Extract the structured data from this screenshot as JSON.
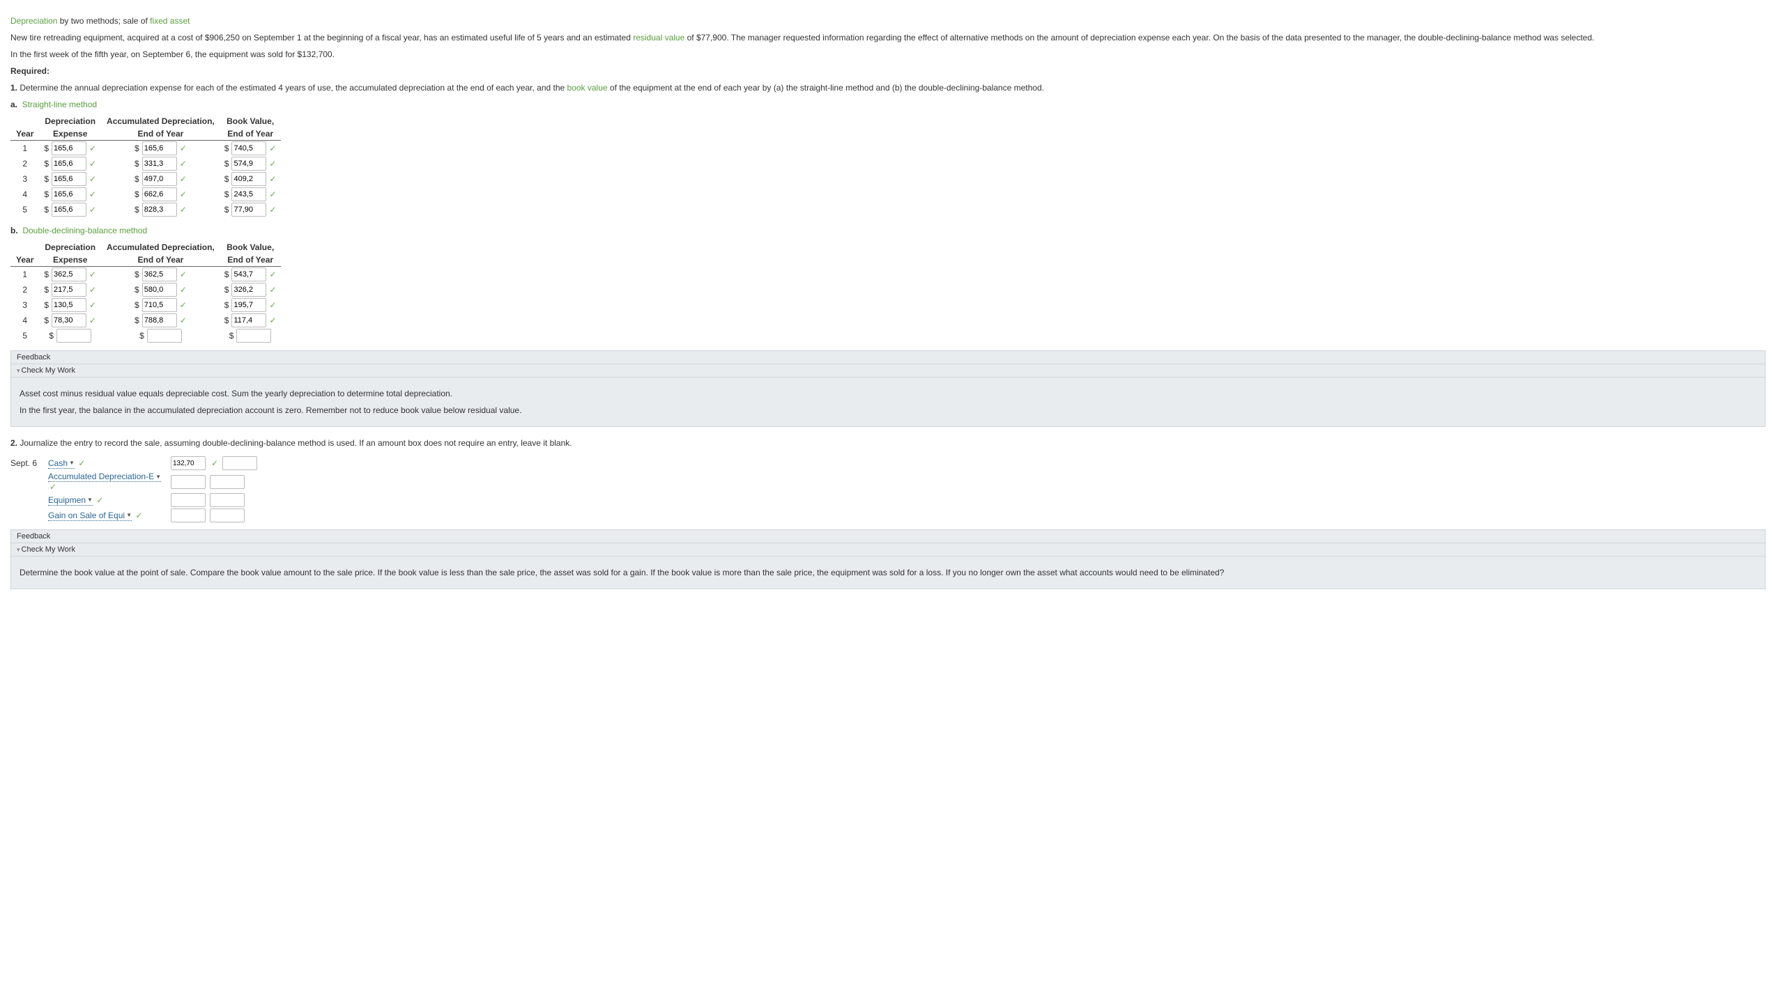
{
  "title": {
    "pre": "Depreciation",
    "mid": " by two methods; sale of ",
    "post": "fixed asset"
  },
  "para1": {
    "a": "New tire retreading equipment, acquired at a cost of $906,250 on September 1 at the beginning of a fiscal year, has an estimated useful life of 5 years and an estimated ",
    "b": "residual value",
    "c": " of $77,900. The manager requested information regarding the effect of alternative methods on the amount of depreciation expense each year. On the basis of the data presented to the manager, the double-declining-balance method was selected."
  },
  "para2": "In the first week of the fifth year, on September 6, the equipment was sold for $132,700.",
  "required": "Required:",
  "q1": {
    "num": "1.",
    "a": " Determine the annual depreciation expense for each of the estimated 4 years of use, the accumulated depreciation at the end of each year, and the ",
    "b": "book value",
    "c": " of the equipment at the end of each year by (a) the straight-line method and (b) the double-declining-balance method."
  },
  "partA": {
    "label": "a.",
    "link": "Straight-line method"
  },
  "partB": {
    "label": "b.",
    "link": "Double-declining-balance method"
  },
  "headers": {
    "year": "Year",
    "dep1": "Depreciation",
    "dep2": "Expense",
    "acc1": "Accumulated Depreciation,",
    "acc2": "End of Year",
    "bv1": "Book Value,",
    "bv2": "End of Year"
  },
  "tableA": [
    {
      "y": "1",
      "d": "165,6",
      "a": "165,6",
      "b": "740,5"
    },
    {
      "y": "2",
      "d": "165,6",
      "a": "331,3",
      "b": "574,9"
    },
    {
      "y": "3",
      "d": "165,6",
      "a": "497,0",
      "b": "409,2"
    },
    {
      "y": "4",
      "d": "165,6",
      "a": "662,6",
      "b": "243,5"
    },
    {
      "y": "5",
      "d": "165,6",
      "a": "828,3",
      "b": "77,90"
    }
  ],
  "tableB": [
    {
      "y": "1",
      "d": "362,5",
      "a": "362,5",
      "b": "543,7"
    },
    {
      "y": "2",
      "d": "217,5",
      "a": "580,0",
      "b": "326,2"
    },
    {
      "y": "3",
      "d": "130,5",
      "a": "710,5",
      "b": "195,7"
    },
    {
      "y": "4",
      "d": "78,30",
      "a": "788,8",
      "b": "117,4"
    },
    {
      "y": "5",
      "d": "",
      "a": "",
      "b": ""
    }
  ],
  "feedback1": {
    "title": "Feedback",
    "sub": "Check My Work",
    "l1": "Asset cost minus residual value equals depreciable cost. Sum the yearly depreciation to determine total depreciation.",
    "l2": "In the first year, the balance in the accumulated depreciation account is zero. Remember not to reduce book value below residual value."
  },
  "q2": {
    "num": "2.",
    "text": " Journalize the entry to record the sale, assuming double-declining-balance method is used. If an amount box does not require an entry, leave it blank."
  },
  "journal": {
    "date": "Sept. 6",
    "rows": [
      {
        "acct": "Cash",
        "debit": "132,70",
        "credit": ""
      },
      {
        "acct": "Accumulated Depreciation-E",
        "debit": "",
        "credit": ""
      },
      {
        "acct": "Equipmen",
        "debit": "",
        "credit": ""
      },
      {
        "acct": "Gain on Sale of Equi",
        "debit": "",
        "credit": ""
      }
    ]
  },
  "feedback2": {
    "title": "Feedback",
    "sub": "Check My Work",
    "l1": "Determine the book value at the point of sale. Compare the book value amount to the sale price. If the book value is less than the sale price, the asset was sold for a gain. If the book value is more than the sale price, the equipment was sold for a loss. If you no longer own the asset what accounts would need to be eliminated?"
  }
}
